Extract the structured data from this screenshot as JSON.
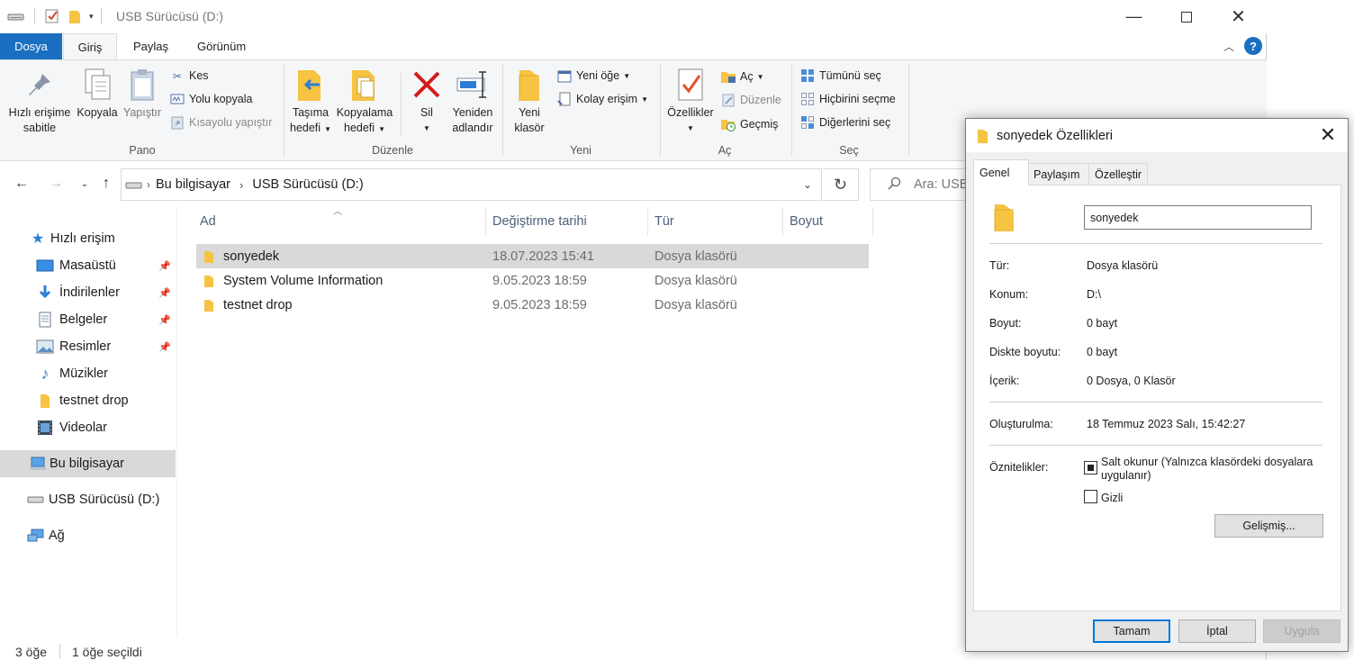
{
  "window": {
    "title": "USB Sürücüsü (D:)"
  },
  "ribbon_tabs": [
    "Dosya",
    "Giriş",
    "Paylaş",
    "Görünüm"
  ],
  "ribbon": {
    "pano": {
      "label": "Pano",
      "pin_line1": "Hızlı erişime",
      "pin_line2": "sabitle",
      "copy": "Kopyala",
      "paste": "Yapıştır",
      "cut": "Kes",
      "copy_path": "Yolu kopyala",
      "paste_shortcut": "Kısayolu yapıştır"
    },
    "duzenle": {
      "label": "Düzenle",
      "move_line1": "Taşıma",
      "move_line2": "hedefi",
      "copyto_line1": "Kopyalama",
      "copyto_line2": "hedefi",
      "delete": "Sil",
      "rename_line1": "Yeniden",
      "rename_line2": "adlandır"
    },
    "yeni": {
      "label": "Yeni",
      "newfolder_line1": "Yeni",
      "newfolder_line2": "klasör",
      "new_item": "Yeni öğe",
      "easy_access": "Kolay erişim"
    },
    "ac": {
      "label": "Aç",
      "properties": "Özellikler",
      "open": "Aç",
      "edit": "Düzenle",
      "history": "Geçmiş"
    },
    "sec": {
      "label": "Seç",
      "select_all": "Tümünü seç",
      "select_none": "Hiçbirini seçme",
      "invert": "Diğerlerini seç"
    }
  },
  "address": {
    "crumbs": [
      "Bu bilgisayar",
      "USB Sürücüsü (D:)"
    ],
    "search_placeholder": "Ara: USB"
  },
  "sidebar": {
    "quick_access": "Hızlı erişim",
    "items": [
      "Masaüstü",
      "İndirilenler",
      "Belgeler",
      "Resimler",
      "Müzikler",
      "testnet drop",
      "Videolar"
    ],
    "this_pc": "Bu bilgisayar",
    "usb": "USB Sürücüsü (D:)",
    "network": "Ağ"
  },
  "columns": [
    "Ad",
    "Değiştirme tarihi",
    "Tür",
    "Boyut"
  ],
  "files": [
    {
      "name": "sonyedek",
      "date": "18.07.2023 15:41",
      "type": "Dosya klasörü"
    },
    {
      "name": "System Volume Information",
      "date": "9.05.2023 18:59",
      "type": "Dosya klasörü"
    },
    {
      "name": "testnet drop",
      "date": "9.05.2023 18:59",
      "type": "Dosya klasörü"
    }
  ],
  "status": {
    "count": "3 öğe",
    "selected": "1 öğe seçildi"
  },
  "dialog": {
    "title": "sonyedek Özellikleri",
    "tabs": [
      "Genel",
      "Paylaşım",
      "Özelleştir"
    ],
    "name_value": "sonyedek",
    "type_label": "Tür:",
    "type_value": "Dosya klasörü",
    "location_label": "Konum:",
    "location_value": "D:\\",
    "size_label": "Boyut:",
    "size_value": "0 bayt",
    "disk_size_label": "Diskte boyutu:",
    "disk_size_value": "0 bayt",
    "contents_label": "İçerik:",
    "contents_value": "0 Dosya, 0 Klasör",
    "created_label": "Oluşturulma:",
    "created_value": "18 Temmuz 2023 Salı, 15:42:27",
    "attributes_label": "Öznitelikler:",
    "readonly_line1": "Salt okunur (Yalnızca klasördeki dosyalara",
    "readonly_line2": "uygulanır)",
    "hidden_label": "Gizli",
    "advanced_button": "Gelişmiş...",
    "ok_button": "Tamam",
    "cancel_button": "İptal",
    "apply_button": "Uygula"
  }
}
